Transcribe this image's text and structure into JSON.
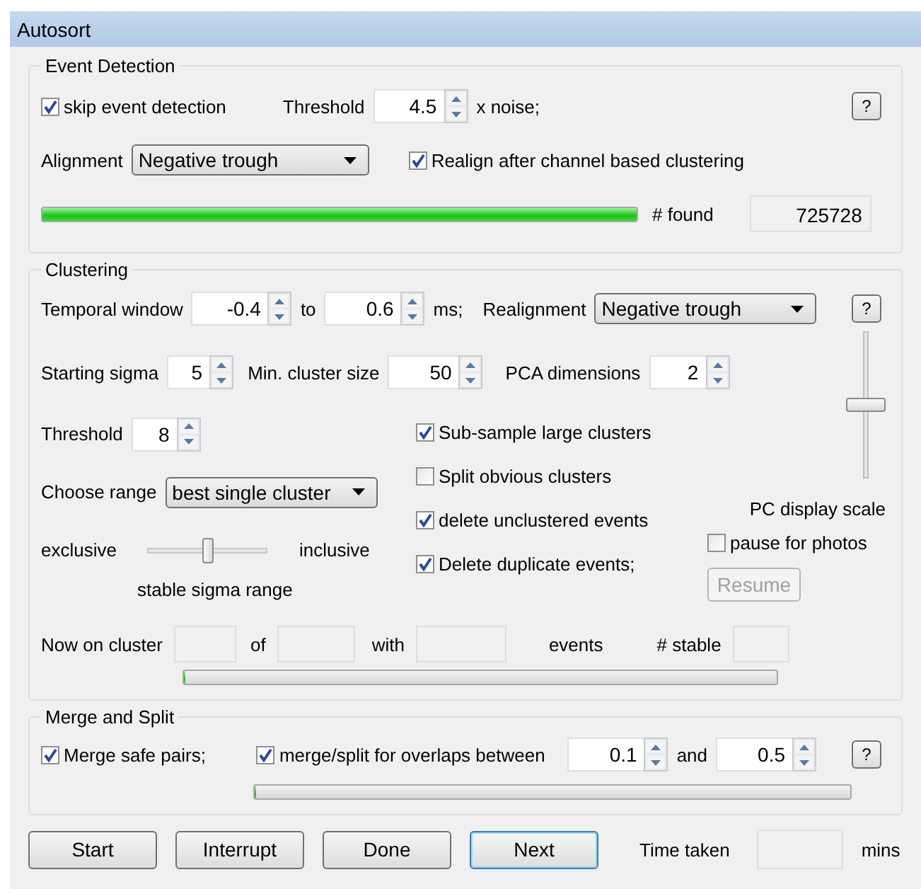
{
  "window": {
    "title": "Autosort"
  },
  "event_detection": {
    "title": "Event Detection",
    "skip": {
      "label": "skip event detection",
      "checked": true
    },
    "threshold": {
      "label": "Threshold",
      "value": "4.5",
      "unit": "x noise;"
    },
    "help": "?",
    "alignment": {
      "label": "Alignment",
      "value": "Negative trough"
    },
    "realign": {
      "label": "Realign after channel based clustering",
      "checked": true
    },
    "progress": {
      "level": 1
    },
    "found": {
      "label": "# found",
      "value": "725728"
    }
  },
  "clustering": {
    "title": "Clustering",
    "temporal": {
      "label": "Temporal window",
      "from": "-0.4",
      "to_label": "to",
      "to": "0.6",
      "unit": "ms;"
    },
    "realignment": {
      "label": "Realignment",
      "value": "Negative trough"
    },
    "help": "?",
    "starting_sigma": {
      "label": "Starting sigma",
      "value": "5"
    },
    "min_cluster": {
      "label": "Min. cluster size",
      "value": "50"
    },
    "pca": {
      "label": "PCA dimensions",
      "value": "2"
    },
    "threshold": {
      "label": "Threshold",
      "value": "8"
    },
    "choose_range": {
      "label": "Choose range",
      "value": "best single cluster"
    },
    "range_slider": {
      "left": "exclusive",
      "right": "inclusive",
      "caption": "stable sigma range",
      "level": 0.5
    },
    "options": [
      {
        "label": "Sub-sample large clusters",
        "checked": true
      },
      {
        "label": "Split obvious clusters",
        "checked": false
      },
      {
        "label": "delete unclustered events",
        "checked": true
      },
      {
        "label": "Delete duplicate events;",
        "checked": true
      }
    ],
    "pc_scale": {
      "label": "PC display scale",
      "level": 0.5
    },
    "pause": {
      "label": "pause for photos",
      "checked": false
    },
    "resume": {
      "label": "Resume",
      "disabled": true
    },
    "status": [
      {
        "kind": "label",
        "text": "Now on cluster"
      },
      {
        "kind": "field"
      },
      {
        "kind": "label",
        "text": "of"
      },
      {
        "kind": "field"
      },
      {
        "kind": "label",
        "text": "with"
      },
      {
        "kind": "field"
      },
      {
        "kind": "label",
        "text": "events"
      },
      {
        "kind": "label",
        "text": "# stable"
      },
      {
        "kind": "field"
      }
    ],
    "progress": {
      "level": 0
    }
  },
  "merge_split": {
    "title": "Merge and Split",
    "merge_safe": {
      "label": "Merge safe pairs;",
      "checked": true
    },
    "overlaps": {
      "label": "merge/split for overlaps between",
      "checked": true
    },
    "low": "0.1",
    "and": "and",
    "high": "0.5",
    "help": "?",
    "progress": {
      "level": 0
    }
  },
  "buttons": [
    {
      "label": "Start",
      "default": false
    },
    {
      "label": "Interrupt",
      "default": false
    },
    {
      "label": "Done",
      "default": false
    },
    {
      "label": "Next",
      "default": true
    }
  ],
  "time_taken": {
    "label": "Time taken",
    "unit": "mins"
  }
}
